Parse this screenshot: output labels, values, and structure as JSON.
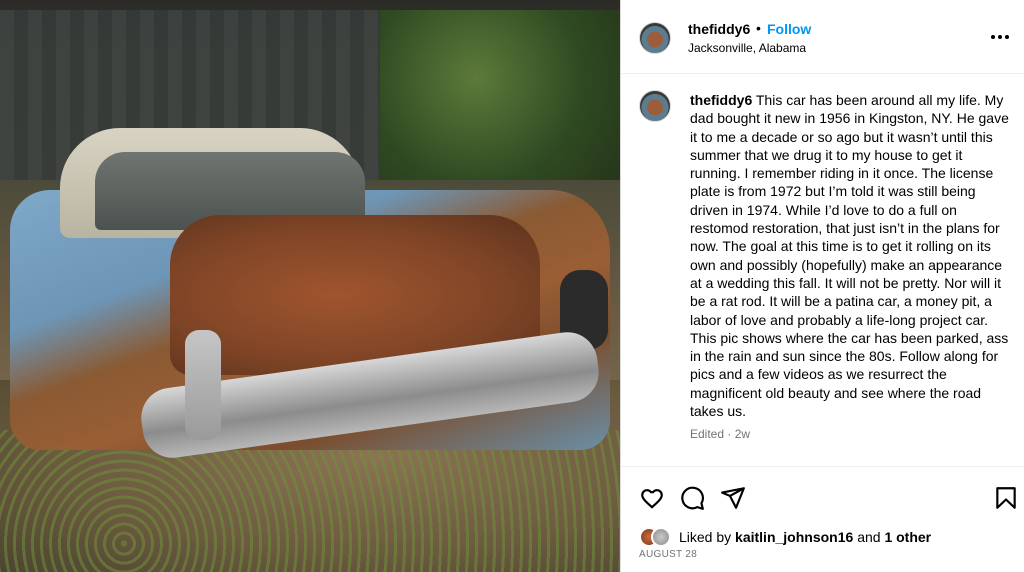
{
  "post": {
    "image": {
      "alt_icon": "photo-of-rusted-classic-car",
      "colors": {
        "body": "#6d95b5",
        "rust": "#9a5e34",
        "roof": "#d8d3c2"
      }
    },
    "header": {
      "username": "thefiddy6",
      "separator": "•",
      "follow_label": "Follow",
      "location": "Jacksonville, Alabama",
      "more_icon": "more-options-icon"
    },
    "caption": {
      "username": "thefiddy6",
      "text": "This car has been around all my life. My dad bought it new in 1956 in Kingston, NY. He gave it to me a decade or so ago but it wasn’t until this summer that we drug it to my house to get it running. I remember riding in it once. The license plate is from 1972 but I’m told it was still being driven in 1974. While I’d love to do a full on restomod restoration, that just isn’t in the plans for now. The goal at this time is to get it rolling on its own and possibly (hopefully) make an appearance at a wedding this fall. It will not be pretty. Nor will it be a rat rod. It will be a patina car, a money pit, a labor of love and probably a life-long project car. This pic shows where the car has been parked, ass in the rain and sun since the 80s. Follow along for pics and a few videos as we resurrect the magnificent old beauty and see where the road takes us.",
      "edited": "Edited",
      "age": "2w"
    },
    "actions": {
      "icons": [
        "heart-icon",
        "comment-icon",
        "share-icon",
        "bookmark-icon"
      ]
    },
    "likes": {
      "prefix": "Liked by",
      "user": "kaitlin_johnson16",
      "conjunction": "and",
      "others": "1 other"
    },
    "date": "AUGUST 28"
  },
  "colors": {
    "accent": "#0095f6",
    "muted": "#737373",
    "border": "#dbdbdb"
  }
}
